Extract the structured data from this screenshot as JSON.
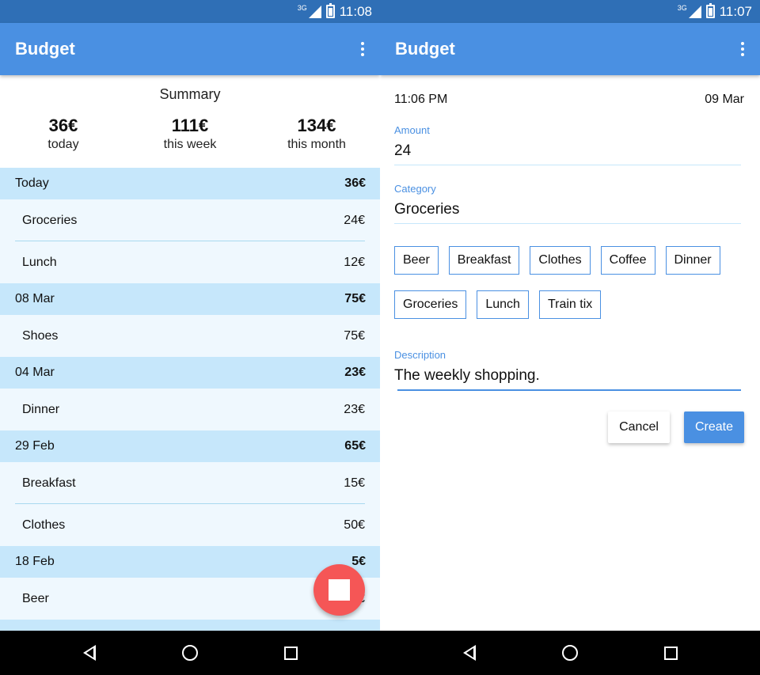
{
  "left": {
    "status_time": "11:08",
    "network": "3G",
    "app_title": "Budget",
    "summary": {
      "title": "Summary",
      "today": {
        "amount": "36€",
        "label": "today"
      },
      "week": {
        "amount": "111€",
        "label": "this week"
      },
      "month": {
        "amount": "134€",
        "label": "this month"
      }
    },
    "days": [
      {
        "date": "Today",
        "total": "36€",
        "items": [
          {
            "name": "Groceries",
            "amount": "24€"
          },
          {
            "name": "Lunch",
            "amount": "12€"
          }
        ]
      },
      {
        "date": "08 Mar",
        "total": "75€",
        "items": [
          {
            "name": "Shoes",
            "amount": "75€"
          }
        ]
      },
      {
        "date": "04 Mar",
        "total": "23€",
        "items": [
          {
            "name": "Dinner",
            "amount": "23€"
          }
        ]
      },
      {
        "date": "29 Feb",
        "total": "65€",
        "items": [
          {
            "name": "Breakfast",
            "amount": "15€"
          },
          {
            "name": "Clothes",
            "amount": "50€"
          }
        ]
      },
      {
        "date": "18 Feb",
        "total": "5€",
        "items": [
          {
            "name": "Beer",
            "amount": "5€"
          }
        ]
      }
    ],
    "fab_icon": "stop-icon"
  },
  "right": {
    "status_time": "11:07",
    "network": "3G",
    "app_title": "Budget",
    "time": "11:06 PM",
    "date": "09 Mar",
    "amount": {
      "label": "Amount",
      "value": "24"
    },
    "category": {
      "label": "Category",
      "value": "Groceries"
    },
    "chips": [
      "Beer",
      "Breakfast",
      "Clothes",
      "Coffee",
      "Dinner",
      "Groceries",
      "Lunch",
      "Train tix"
    ],
    "description": {
      "label": "Description",
      "value": "The weekly shopping."
    },
    "cancel_label": "Cancel",
    "create_label": "Create"
  },
  "colors": {
    "status_bar": "#2f6fb6",
    "app_bar": "#4a90e2",
    "day_row": "#c6e7fb",
    "item_row": "#eff8fe",
    "fab": "#f55656"
  }
}
